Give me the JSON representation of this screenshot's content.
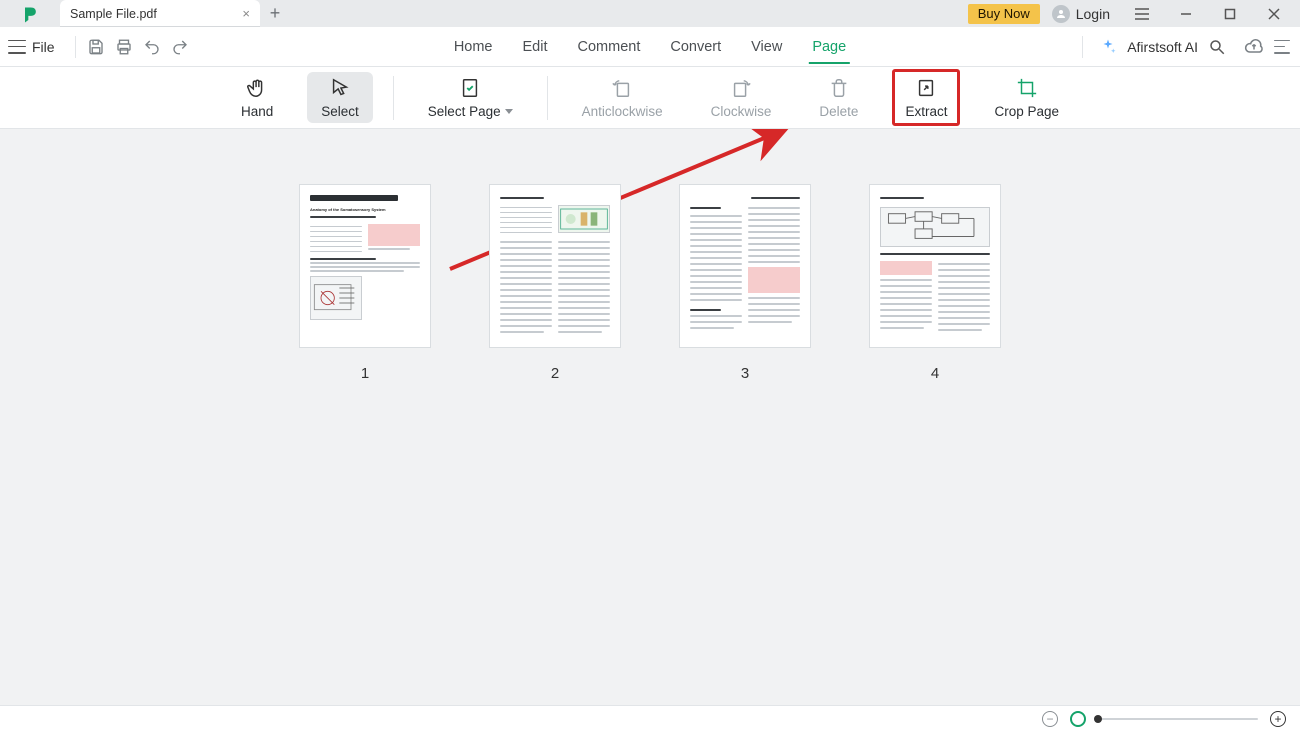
{
  "tab": {
    "title": "Sample File.pdf"
  },
  "titlebar": {
    "buy_label": "Buy Now",
    "login_label": "Login"
  },
  "topstrip": {
    "file_label": "File",
    "tabs": {
      "home": "Home",
      "edit": "Edit",
      "comment": "Comment",
      "convert": "Convert",
      "view": "View",
      "page": "Page"
    },
    "ai_label": "Afirstsoft AI"
  },
  "ribbon": {
    "hand": "Hand",
    "select": "Select",
    "select_page": "Select Page",
    "anticlockwise": "Anticlockwise",
    "clockwise": "Clockwise",
    "delete": "Delete",
    "extract": "Extract",
    "crop_page": "Crop Page"
  },
  "pages": {
    "p1": "1",
    "p2": "2",
    "p3": "3",
    "p4": "4",
    "p1_title": "Anatomy of the Somatosensory System"
  },
  "annotation": {
    "arrow_from": "page-thumbnail-1",
    "arrow_to": "extract-button",
    "highlighted_tool": "Extract"
  },
  "colors": {
    "accent": "#15a36a",
    "annotation_red": "#d62828",
    "buy_yellow": "#f4c34a",
    "highlight_pink": "#f6cccc"
  }
}
